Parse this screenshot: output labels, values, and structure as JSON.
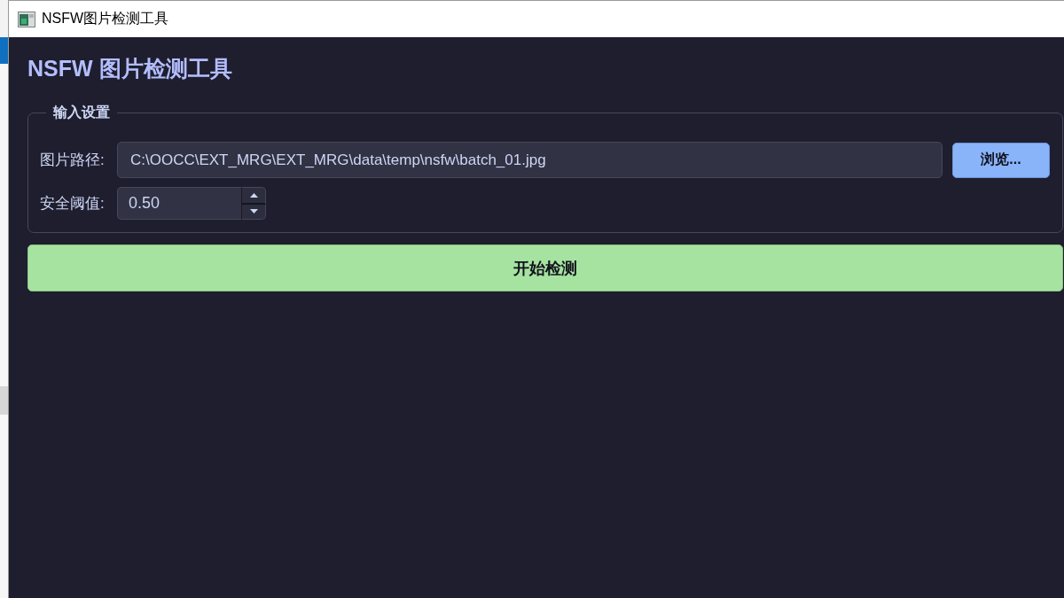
{
  "window": {
    "title": "NSFW图片检测工具"
  },
  "heading": "NSFW 图片检测工具",
  "input_settings": {
    "title": "输入设置",
    "image_path": {
      "label": "图片路径:",
      "value": "C:\\OOCC\\EXT_MRG\\EXT_MRG\\data\\temp\\nsfw\\batch_01.jpg"
    },
    "browse_button": "浏览...",
    "threshold": {
      "label": "安全阈值:",
      "value": "0.50"
    }
  },
  "start_button": "开始检测"
}
